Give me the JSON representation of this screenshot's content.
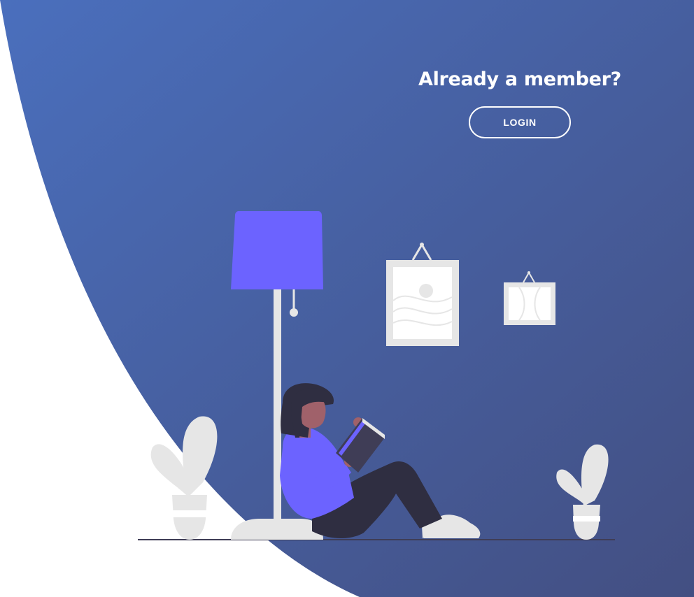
{
  "panel": {
    "title": "Already a member?",
    "login_label": "LOGIN"
  },
  "colors": {
    "gradient_start": "#4a6cb6",
    "gradient_end": "#445385",
    "accent": "#6c63ff",
    "light_gray": "#e6e6e6",
    "dark": "#2f2e41",
    "skin": "#a0616a"
  },
  "illustration": {
    "name": "person-reading-under-lamp"
  }
}
